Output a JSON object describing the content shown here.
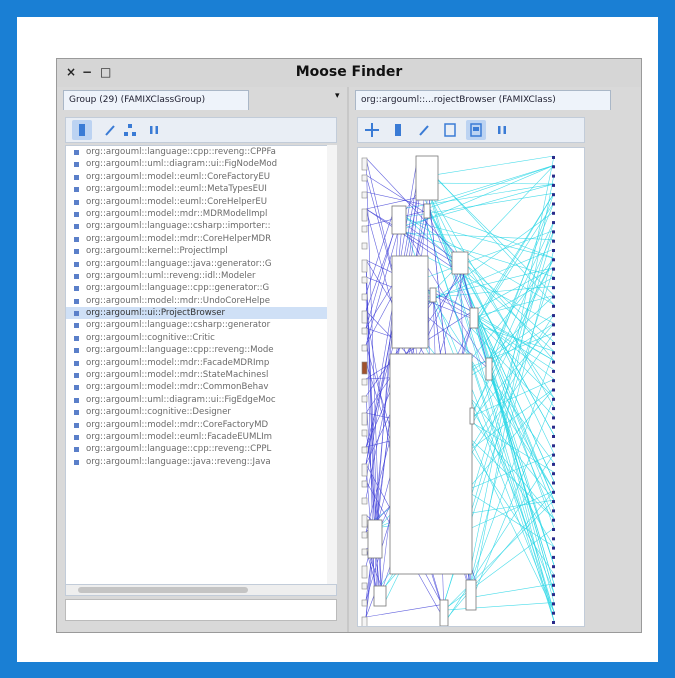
{
  "window": {
    "title": "Moose Finder",
    "controls": {
      "close": "×",
      "minimize": "−",
      "maximize": "□"
    }
  },
  "left_pane": {
    "tab_label": "Group (29) (FAMIXClassGroup)",
    "dropdown_glyph": "▾",
    "toolbar": [
      "list-icon",
      "edit-icon",
      "tree-icon",
      "pause-icon"
    ],
    "items": [
      "org::argouml::language::cpp::reveng::CPPFa",
      "org::argouml::uml::diagram::ui::FigNodeMod",
      "org::argouml::model::euml::CoreFactoryEU",
      "org::argouml::model::euml::MetaTypesEUI",
      "org::argouml::model::euml::CoreHelperEU",
      "org::argouml::model::mdr::MDRModelImpl",
      "org::argouml::language::csharp::importer::",
      "org::argouml::model::mdr::CoreHelperMDR",
      "org::argouml::kernel::ProjectImpl",
      "org::argouml::language::java::generator::G",
      "org::argouml::uml::reveng::idl::Modeler",
      "org::argouml::language::cpp::generator::G",
      "org::argouml::model::mdr::UndoCoreHelpe",
      "org::argouml::ui::ProjectBrowser",
      "org::argouml::language::csharp::generator",
      "org::argouml::cognitive::Critic",
      "org::argouml::language::cpp::reveng::Mode",
      "org::argouml::model::mdr::FacadeMDRImp",
      "org::argouml::model::mdr::StateMachinesl",
      "org::argouml::model::mdr::CommonBehav",
      "org::argouml::uml::diagram::ui::FigEdgeMoc",
      "org::argouml::cognitive::Designer",
      "org::argouml::model::mdr::CoreFactoryMD",
      "org::argouml::model::euml::FacadeEUMLIm",
      "org::argouml::language::cpp::reveng::CPPL",
      "org::argouml::language::java::reveng::Java"
    ],
    "selected_index": 13
  },
  "right_pane": {
    "tab_label": "org::argouml::...rojectBrowser (FAMIXClass)",
    "toolbar": [
      "move-icon",
      "list-icon",
      "edit-icon",
      "page-icon",
      "image-icon",
      "pause-icon"
    ]
  },
  "colors": {
    "frame": "#1a7fd4",
    "edge_cyan": "#28d6e6",
    "edge_blue": "#3a3ad6"
  }
}
